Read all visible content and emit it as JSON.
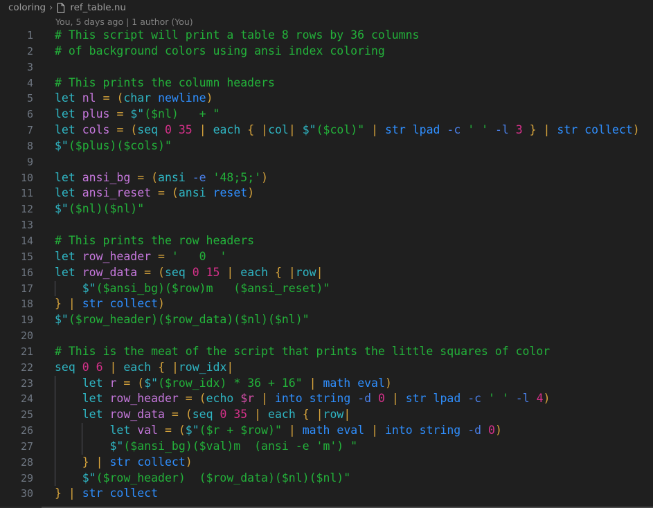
{
  "breadcrumb": {
    "folder": "coloring",
    "separator": "›",
    "file": "ref_table.nu",
    "file_icon": "file-document-icon"
  },
  "codelens": {
    "text": "You, 5 days ago | 1 author (You)"
  },
  "editor": {
    "language": "nushell",
    "first_line": 1,
    "last_line": 30,
    "colors": {
      "background": "#1f1f1f",
      "line_number": "#6e7681",
      "comment": "#23b23a",
      "keyword": "#2fb6c4",
      "variable": "#c678dd",
      "operator": "#d7a43c",
      "number": "#d6318a",
      "string": "#23b23a",
      "flag": "#4a7fe8",
      "subcommand": "#2f8fff"
    },
    "lines": [
      {
        "n": "1",
        "text": "# This script will print a table 8 rows by 36 columns"
      },
      {
        "n": "2",
        "text": "# of background colors using ansi index coloring"
      },
      {
        "n": "3",
        "text": ""
      },
      {
        "n": "4",
        "text": "# This prints the column headers"
      },
      {
        "n": "5",
        "text": "let nl = (char newline)"
      },
      {
        "n": "6",
        "text": "let plus = $\"($nl)   + \""
      },
      {
        "n": "7",
        "text": "let cols = (seq 0 35 | each { |col| $\"($col)\" | str lpad -c ' ' -l 3 } | str collect)"
      },
      {
        "n": "8",
        "text": "$\"($plus)($cols)\""
      },
      {
        "n": "9",
        "text": ""
      },
      {
        "n": "10",
        "text": "let ansi_bg = (ansi -e '48;5;')"
      },
      {
        "n": "11",
        "text": "let ansi_reset = (ansi reset)"
      },
      {
        "n": "12",
        "text": "$\"($nl)($nl)\""
      },
      {
        "n": "13",
        "text": ""
      },
      {
        "n": "14",
        "text": "# This prints the row headers"
      },
      {
        "n": "15",
        "text": "let row_header = '   0  '"
      },
      {
        "n": "16",
        "text": "let row_data = (seq 0 15 | each { |row|"
      },
      {
        "n": "17",
        "text": "    $\"($ansi_bg)($row)m   ($ansi_reset)\""
      },
      {
        "n": "18",
        "text": "} | str collect)"
      },
      {
        "n": "19",
        "text": "$\"($row_header)($row_data)($nl)($nl)\""
      },
      {
        "n": "20",
        "text": ""
      },
      {
        "n": "21",
        "text": "# This is the meat of the script that prints the little squares of color"
      },
      {
        "n": "22",
        "text": "seq 0 6 | each { |row_idx|"
      },
      {
        "n": "23",
        "text": "    let r = ($\"($row_idx) * 36 + 16\" | math eval)"
      },
      {
        "n": "24",
        "text": "    let row_header = (echo $r | into string -d 0 | str lpad -c ' ' -l 4)"
      },
      {
        "n": "25",
        "text": "    let row_data = (seq 0 35 | each { |row|"
      },
      {
        "n": "26",
        "text": "        let val = ($\"($r + $row)\" | math eval | into string -d 0)"
      },
      {
        "n": "27",
        "text": "        $\"($ansi_bg)($val)m  (ansi -e 'm') \""
      },
      {
        "n": "28",
        "text": "    } | str collect)"
      },
      {
        "n": "29",
        "text": "    $\"($row_header)  ($row_data)($nl)($nl)\""
      },
      {
        "n": "30",
        "text": "} | str collect"
      }
    ]
  }
}
